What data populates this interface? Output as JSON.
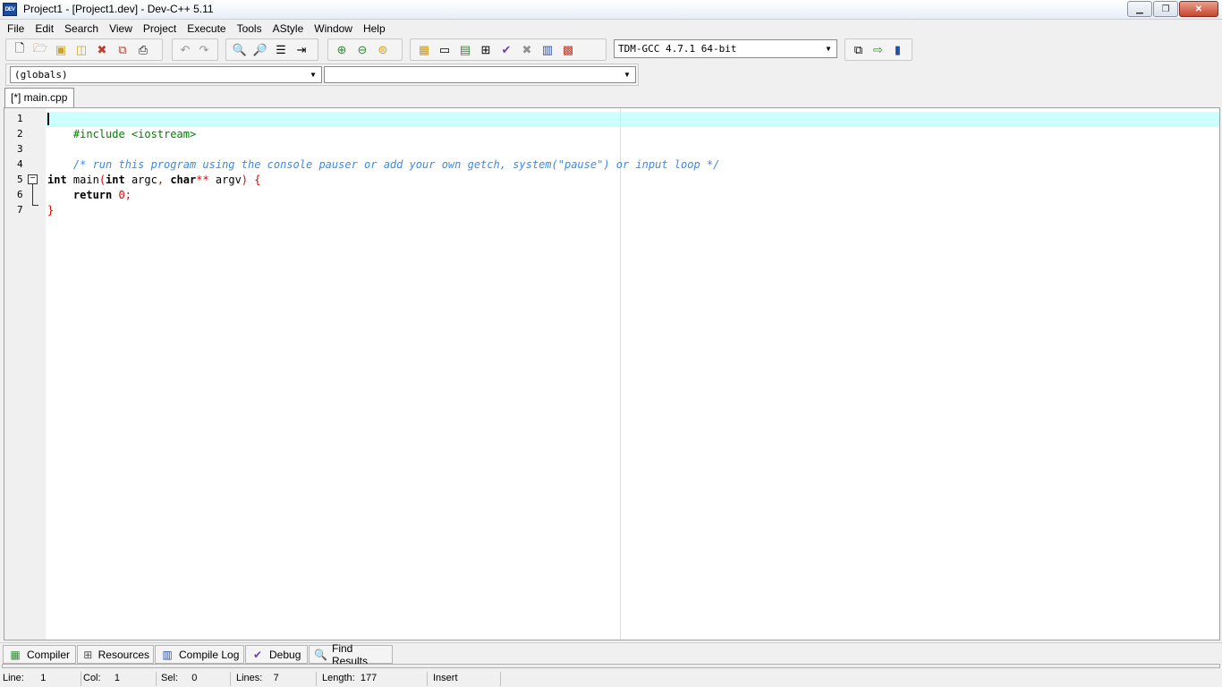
{
  "window": {
    "title": "Project1 - [Project1.dev] - Dev-C++ 5.11",
    "icon_text": "DEV",
    "controls": [
      "minimize-icon",
      "maximize-icon",
      "close-icon"
    ]
  },
  "menu": [
    "File",
    "Edit",
    "Search",
    "View",
    "Project",
    "Execute",
    "Tools",
    "AStyle",
    "Window",
    "Help"
  ],
  "toolbar": {
    "compiler_selected": "TDM-GCC 4.7.1 64-bit"
  },
  "class_browser": {
    "scope_selected": "(globals)",
    "member_selected": ""
  },
  "tabs": [
    {
      "label": "[*] main.cpp"
    }
  ],
  "editor": {
    "line_numbers": [
      "1",
      "2",
      "3",
      "4",
      "5",
      "6",
      "7"
    ],
    "line1": {
      "pre": "#include <iostream>"
    },
    "line3": {
      "comment": "/* run this program using the console pauser or add your own getch, system(\"pause\") or input loop */"
    },
    "line5": {
      "kw1": "int",
      "t1": " main",
      "p1": "(",
      "kw2": "int",
      "t2": " argc",
      "p2": ",",
      "kw3": " char",
      "p3": "**",
      "t3": " argv",
      "p4": ")",
      "p5": " {"
    },
    "line6": {
      "kw": "    return",
      "num": " 0",
      "p": ";"
    },
    "line7": {
      "p": "}"
    },
    "active_line_color": "#ccffff"
  },
  "bottom_tabs": [
    {
      "label": "Compiler",
      "icon": "compiler-icon"
    },
    {
      "label": "Resources",
      "icon": "resources-icon"
    },
    {
      "label": "Compile Log",
      "icon": "compile-log-icon"
    },
    {
      "label": "Debug",
      "icon": "debug-icon"
    },
    {
      "label": "Find Results",
      "icon": "find-results-icon"
    }
  ],
  "status": {
    "line_label": "Line:",
    "line_val": "1",
    "col_label": "Col:",
    "col_val": "1",
    "sel_label": "Sel:",
    "sel_val": "0",
    "lines_label": "Lines:",
    "lines_val": "7",
    "length_label": "Length:",
    "length_val": "177",
    "mode": "Insert"
  }
}
